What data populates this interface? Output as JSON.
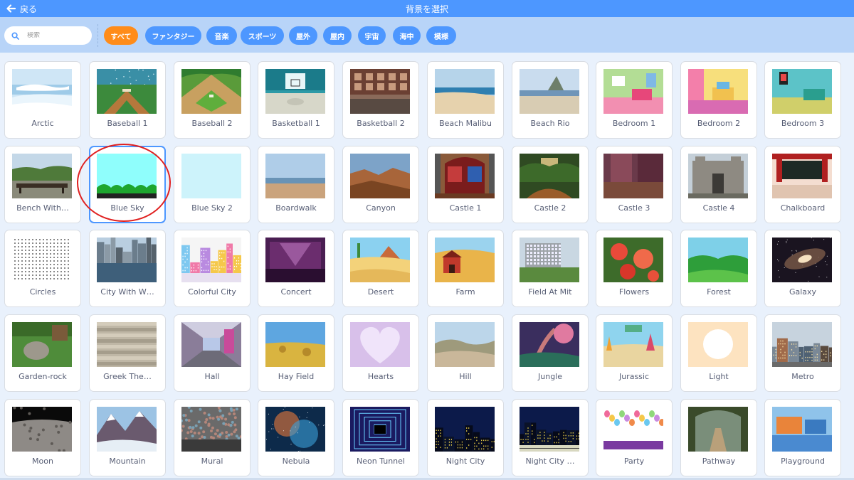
{
  "header": {
    "back_label": "戻る",
    "title": "背景を選択"
  },
  "search": {
    "placeholder": "検索"
  },
  "filters": [
    "すべて",
    "ファンタジー",
    "音楽",
    "スポーツ",
    "屋外",
    "屋内",
    "宇宙",
    "海中",
    "模様"
  ],
  "active_filter": "すべて",
  "selected_item": "Blue Sky",
  "colors": {
    "header": "#4d97ff",
    "filter_bar": "#b8d4f8",
    "active_tag": "#ff8c1a",
    "tag": "#4d97ff",
    "highlight_circle": "#e02020"
  },
  "backdrops": [
    [
      "Arctic",
      "Baseball 1",
      "Baseball 2",
      "Basketball 1",
      "Basketball 2",
      "Beach Malibu",
      "Beach Rio",
      "Bedroom 1",
      "Bedroom 2",
      "Bedroom 3"
    ],
    [
      "Bench With…",
      "Blue Sky",
      "Blue Sky 2",
      "Boardwalk",
      "Canyon",
      "Castle 1",
      "Castle 2",
      "Castle 3",
      "Castle 4",
      "Chalkboard"
    ],
    [
      "Circles",
      "City With W…",
      "Colorful City",
      "Concert",
      "Desert",
      "Farm",
      "Field At Mit",
      "Flowers",
      "Forest",
      "Galaxy"
    ],
    [
      "Garden-rock",
      "Greek The…",
      "Hall",
      "Hay Field",
      "Hearts",
      "Hill",
      "Jungle",
      "Jurassic",
      "Light",
      "Metro"
    ],
    [
      "Moon",
      "Mountain",
      "Mural",
      "Nebula",
      "Neon Tunnel",
      "Night City",
      "Night City …",
      "Party",
      "Pathway",
      "Playground"
    ]
  ]
}
